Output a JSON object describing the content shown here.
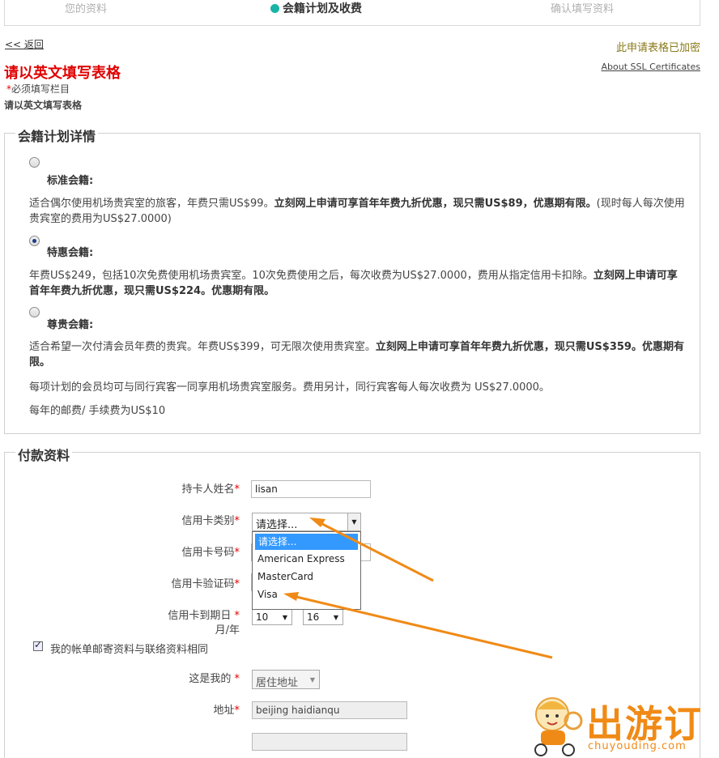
{
  "steps": {
    "step1": "您的资料",
    "step2": "会籍计划及收费",
    "step3": "确认填写资料"
  },
  "nav": {
    "back": "<< 返回",
    "encrypted": "此申请表格已加密",
    "ssl": "About SSL Certificates"
  },
  "header": {
    "title": "请以英文填写表格",
    "required_star": "*",
    "required_note": "必须填写栏目",
    "sub_note": "请以英文填写表格"
  },
  "plans": {
    "legend": "会籍计划详情",
    "standard": {
      "name": "标准会籍:",
      "desc_a": "适合偶尔使用机场贵宾室的旅客，年费只需US$99。",
      "desc_b": "立刻网上申请可享首年年费九折优惠，现只需US$89，优惠期有限。",
      "desc_c": "(现时每人每次使用贵宾室的费用为US$27.0000)"
    },
    "preferential": {
      "name": "特惠会籍:",
      "desc_a": "年费US$249，包括10次免费使用机场贵宾室。10次免费使用之后，每次收费为US$27.0000，费用从指定信用卡扣除。",
      "desc_b": "立刻网上申请可享首年年费九折优惠，现只需US$224。优惠期有限。"
    },
    "premium": {
      "name": "尊贵会籍:",
      "desc_a": "适合希望一次付清会员年费的贵宾。年费US$399，可无限次使用贵宾室。",
      "desc_b": "立刻网上申请可享首年年费九折优惠，现只需US$359。优惠期有限。"
    },
    "guest_note": "每项计划的会员均可与同行宾客一同享用机场贵宾室服务。费用另计，同行宾客每人每次收费为 US$27.0000。",
    "postage_note": "每年的邮费/ 手续费为US$10"
  },
  "payment": {
    "legend": "付款资料",
    "star": "*",
    "cardholder_label": "持卡人姓名",
    "cardholder_value": "lisan",
    "card_type_label": "信用卡类别",
    "card_type_value": "请选择...",
    "card_type_options": [
      "请选择...",
      "American Express",
      "MasterCard",
      "Visa"
    ],
    "card_number_label": "信用卡号码",
    "cvv_label": "信用卡验证码",
    "expiry_label": "信用卡到期日",
    "expiry_sub": "月/年",
    "expiry_month": "10",
    "expiry_year": "16",
    "same_address_label": "我的帐单邮寄资料与联络资料相同",
    "this_is_my_label": "这是我的",
    "this_is_my_value": "居住地址",
    "address_label": "地址",
    "address_line1": "beijing haidianqu",
    "address_line2": ""
  },
  "logo": {
    "cn": "出游订",
    "en": "chuyouding.com"
  },
  "colors": {
    "accent_teal": "#1ab3a6",
    "required_red": "#e00000",
    "annotation_orange": "#f08a16",
    "selection_blue": "#3399ff"
  }
}
